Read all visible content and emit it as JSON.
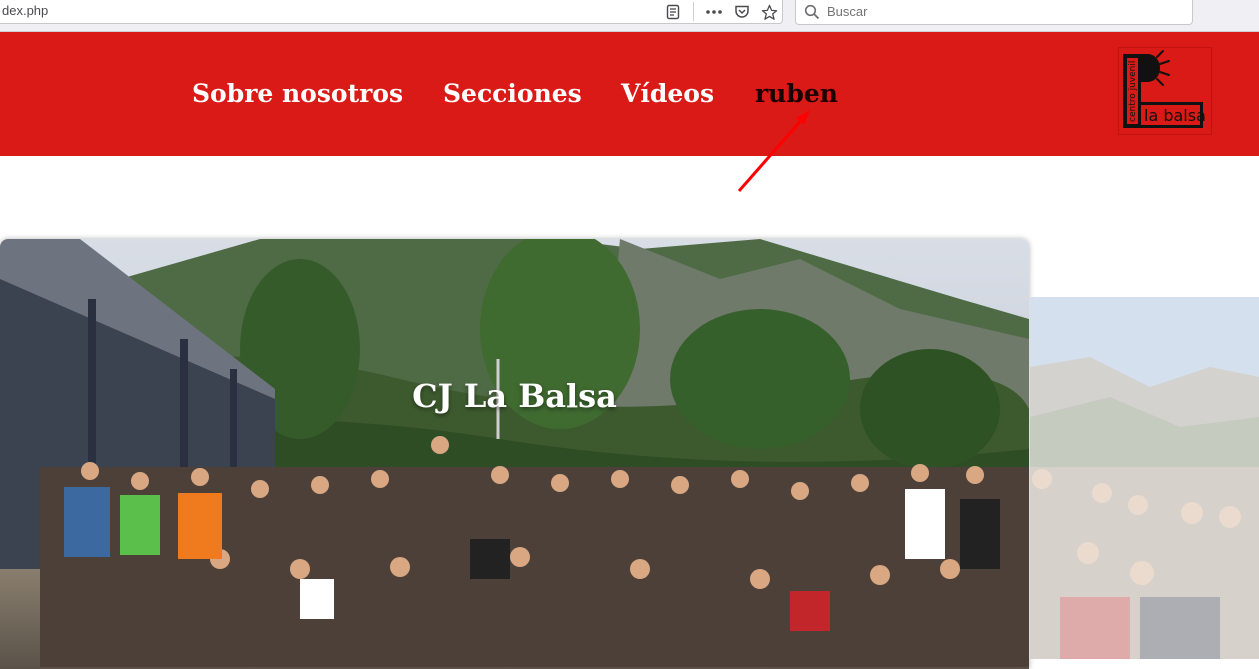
{
  "browser": {
    "url": "dex.php",
    "search_placeholder": "Buscar",
    "icons": [
      "reader-view-icon",
      "more-icon",
      "pocket-icon",
      "bookmark-star-icon",
      "search-icon"
    ]
  },
  "header": {
    "nav": [
      "Sobre nosotros",
      "Secciones",
      "Vídeos",
      "ruben"
    ],
    "logo": {
      "text_vertical": "centro juvenil",
      "text_main": "la balsa"
    },
    "colors": {
      "background": "#d91a16",
      "nav_text": "#ffffff",
      "highlighted_nav_text": "#1a0000"
    }
  },
  "hero": {
    "title": "CJ La Balsa",
    "main_image": "group photo of young people in a mountain valley",
    "next_image": "group photo with mountains and sky"
  },
  "annotation": {
    "type": "red-arrow",
    "color": "#ff0000",
    "points_to": "ruben"
  }
}
